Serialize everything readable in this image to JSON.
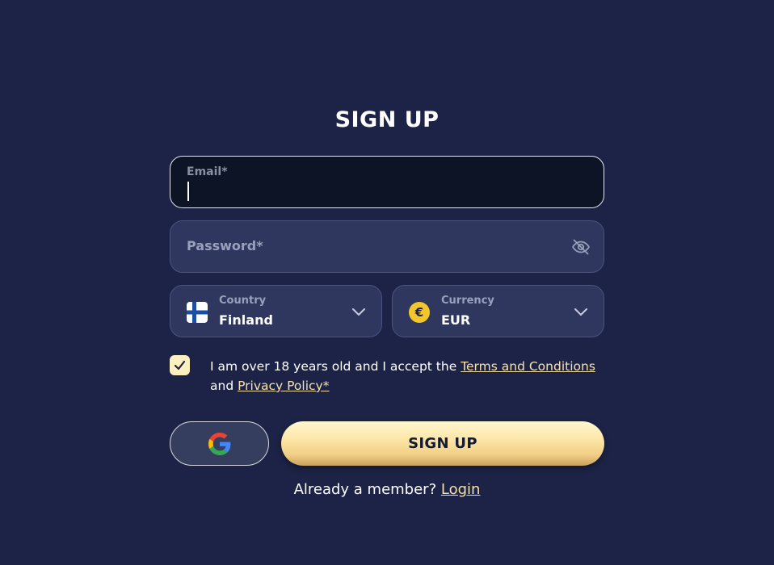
{
  "form": {
    "title": "SIGN UP",
    "email": {
      "label": "Email*",
      "value": ""
    },
    "password": {
      "placeholder": "Password*",
      "value": "",
      "toggle_icon": "eye-slash-icon"
    },
    "country": {
      "label": "Country",
      "value": "Finland",
      "icon": "finland-flag-icon"
    },
    "currency": {
      "label": "Currency",
      "value": "EUR",
      "icon": "euro-coin-icon",
      "symbol": "€"
    },
    "consent": {
      "checked": true,
      "text_before": "I am over 18 years old and I accept the ",
      "terms_link": "Terms and Conditions",
      "text_middle": " and ",
      "privacy_link": "Privacy Policy*"
    },
    "google_button": {
      "icon": "google-icon"
    },
    "submit_label": "SIGN UP",
    "member_prompt": "Already a member? ",
    "login_link": "Login"
  },
  "colors": {
    "background": "#1c2346",
    "field": "#2f375e",
    "active_field": "#0d1425",
    "accent_gold": "#f6e2a9",
    "euro_coin": "#f3c62b"
  }
}
